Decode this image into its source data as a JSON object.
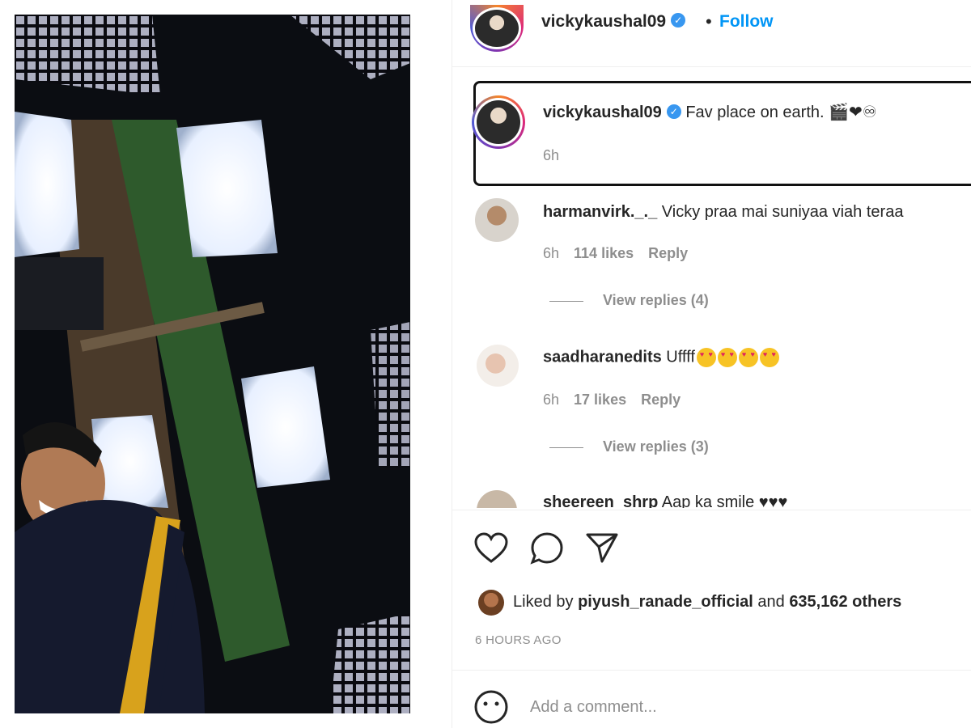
{
  "post": {
    "username": "vickykaushal09",
    "follow_label": "Follow",
    "separator": "•"
  },
  "caption": {
    "username": "vickykaushal09",
    "text": "Fav place on earth. 🎬❤♾",
    "time": "6h"
  },
  "comments": [
    {
      "username": "harmanvirk._._",
      "text": "Vicky praa mai suniyaa viah teraa",
      "time": "6h",
      "likes": "114 likes",
      "reply_label": "Reply",
      "view_replies": "View replies (4)"
    },
    {
      "username": "saadharanedits",
      "text": "Uffff",
      "time": "6h",
      "likes": "17 likes",
      "reply_label": "Reply",
      "view_replies": "View replies (3)"
    },
    {
      "username": "sheereen_shrp",
      "text": "Aap ka smile"
    }
  ],
  "likes": {
    "prefix": "Liked by",
    "user": "piyush_ranade_official",
    "middle": "and",
    "count": "635,162 others"
  },
  "posted": "6 HOURS AGO",
  "add_comment_placeholder": "Add a comment...",
  "colors": {
    "link_blue": "#0095f6",
    "verified_blue": "#3897f0",
    "muted_gray": "#8e8e8e"
  },
  "icons": [
    "verified-icon",
    "heart-icon",
    "comment-icon",
    "share-icon",
    "emoji-icon"
  ]
}
